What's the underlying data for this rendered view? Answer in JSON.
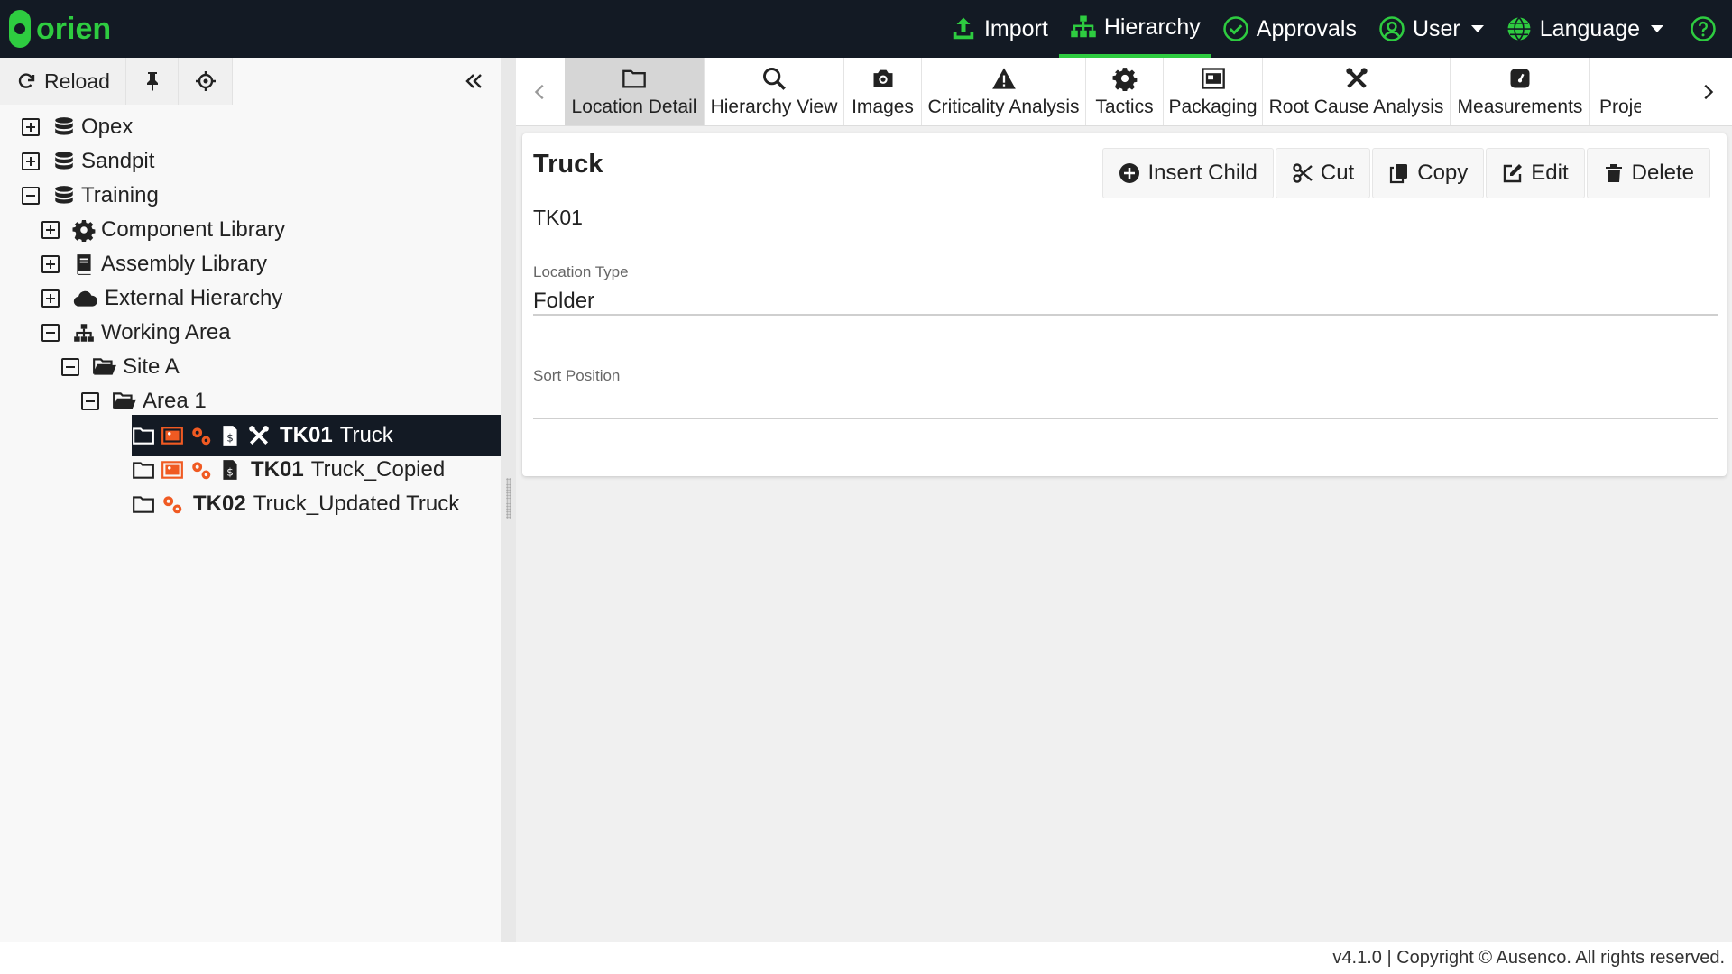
{
  "app": {
    "logo_text": "orien",
    "brand_color": "#2ecc40",
    "topbar_color": "#131a24"
  },
  "topnav": {
    "import": "Import",
    "hierarchy": "Hierarchy",
    "approvals": "Approvals",
    "user": "User",
    "language": "Language",
    "help_icon": "question-circle-icon"
  },
  "left_toolbar": {
    "reload": "Reload",
    "pin_icon": "pin-icon",
    "locate_icon": "crosshair-icon",
    "collapse_icon": "double-chevron-left-icon"
  },
  "tree": {
    "opex": "Opex",
    "sandpit": "Sandpit",
    "training": "Training",
    "component_library": "Component Library",
    "assembly_library": "Assembly Library",
    "external_hierarchy": "External Hierarchy",
    "working_area": "Working Area",
    "site_a": "Site A",
    "area_1": "Area 1",
    "item1": {
      "code": "TK01",
      "name": "Truck"
    },
    "item2": {
      "code": "TK01",
      "name": "Truck_Copied"
    },
    "item3": {
      "code": "TK02",
      "name": "Truck_Updated Truck"
    }
  },
  "tabs": {
    "location_detail": "Location Detail",
    "hierarchy_view": "Hierarchy View",
    "images": "Images",
    "criticality_analysis": "Criticality Analysis",
    "tactics": "Tactics",
    "packaging": "Packaging",
    "root_cause_analysis": "Root Cause Analysis",
    "measurements": "Measurements",
    "projects_partial": "Proje"
  },
  "detail": {
    "title": "Truck",
    "code": "TK01",
    "location_type_label": "Location Type",
    "location_type_value": "Folder",
    "sort_position_label": "Sort Position",
    "sort_position_value": ""
  },
  "actions": {
    "insert_child": "Insert Child",
    "cut": "Cut",
    "copy": "Copy",
    "edit": "Edit",
    "delete": "Delete"
  },
  "footer": "v4.1.0 | Copyright © Ausenco. All rights reserved."
}
